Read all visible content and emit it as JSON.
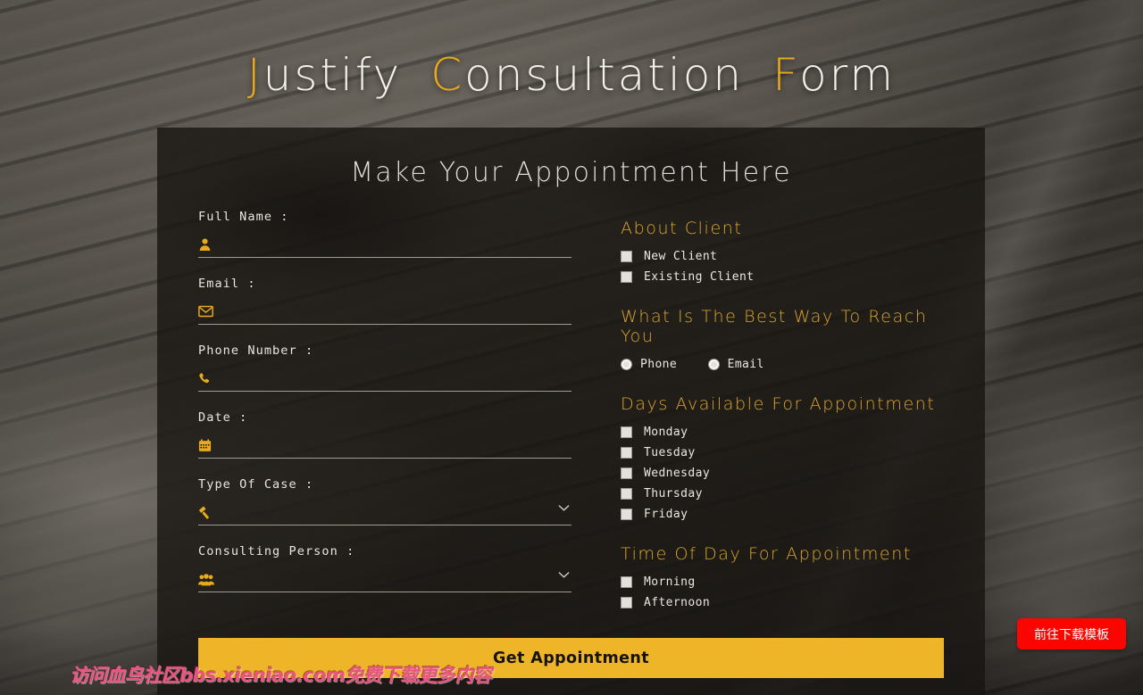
{
  "header": {
    "title_parts": [
      {
        "cap": "J",
        "rest": "ustify"
      },
      {
        "cap": "C",
        "rest": "onsultation"
      },
      {
        "cap": "F",
        "rest": "orm"
      }
    ],
    "title_full": "Justify Consultation Form"
  },
  "form": {
    "heading": "Make Your Appointment Here",
    "left_fields": [
      {
        "label": "Full Name :",
        "icon": "user-icon",
        "type": "text",
        "value": "",
        "placeholder": ""
      },
      {
        "label": "Email :",
        "icon": "envelope-icon",
        "type": "email",
        "value": "",
        "placeholder": ""
      },
      {
        "label": "Phone Number :",
        "icon": "phone-icon",
        "type": "tel",
        "value": "",
        "placeholder": ""
      },
      {
        "label": "Date :",
        "icon": "calendar-icon",
        "type": "date",
        "value": "",
        "placeholder": ""
      },
      {
        "label": "Type Of Case :",
        "icon": "gavel-icon",
        "type": "select",
        "value": "",
        "placeholder": ""
      },
      {
        "label": "Consulting Person :",
        "icon": "users-icon",
        "type": "select",
        "value": "",
        "placeholder": ""
      }
    ],
    "groups": [
      {
        "title": "About Client",
        "control": "checkbox",
        "layout": "stacked",
        "options": [
          {
            "label": "New Client",
            "checked": false
          },
          {
            "label": "Existing Client",
            "checked": false
          }
        ]
      },
      {
        "title": "What Is The Best Way To Reach You",
        "control": "radio",
        "layout": "inline",
        "options": [
          {
            "label": "Phone",
            "checked": false
          },
          {
            "label": "Email",
            "checked": false
          }
        ]
      },
      {
        "title": "Days Available For Appointment",
        "control": "checkbox",
        "layout": "stacked",
        "options": [
          {
            "label": "Monday",
            "checked": false
          },
          {
            "label": "Tuesday",
            "checked": false
          },
          {
            "label": "Wednesday",
            "checked": false
          },
          {
            "label": "Thursday",
            "checked": false
          },
          {
            "label": "Friday",
            "checked": false
          }
        ]
      },
      {
        "title": "Time Of Day For Appointment",
        "control": "checkbox",
        "layout": "stacked",
        "options": [
          {
            "label": "Morning",
            "checked": false
          },
          {
            "label": "Afternoon",
            "checked": false
          }
        ]
      }
    ],
    "submit_label": "Get Appointment"
  },
  "overlay": {
    "watermark": "访问血鸟社区bbs.xieniao.com免费下载更多内容",
    "download_button": "前往下载模板"
  },
  "colors": {
    "accent_gold": "#e8a91d",
    "heading_gold": "#dba62a",
    "button_gold": "#eeb528",
    "panel_bg": "#181511",
    "watermark_pink": "#e8557f",
    "float_button_red": "#fb0500"
  }
}
